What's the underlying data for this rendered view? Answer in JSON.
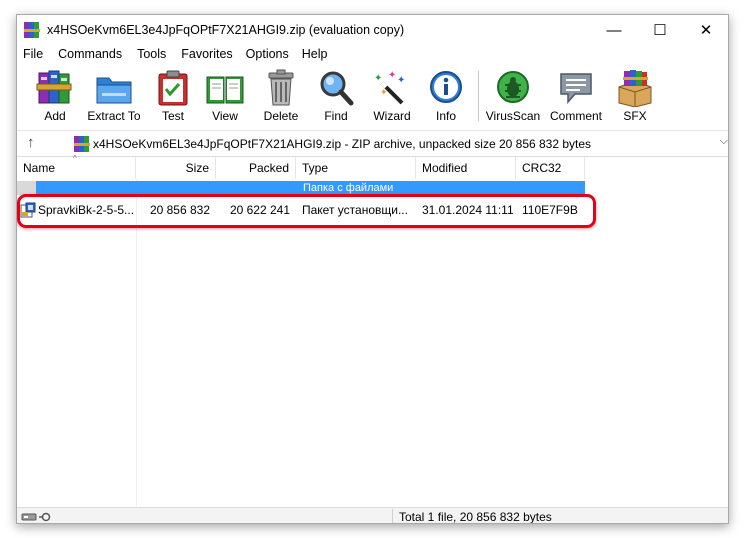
{
  "window": {
    "title": "x4HSOeKvm6EL3e4JpFqOPtF7X21AHGI9.zip (evaluation copy)",
    "minimize_glyph": "—",
    "maximize_glyph": "☐",
    "close_glyph": "✕"
  },
  "menu": [
    "File",
    "Commands",
    "Tools",
    "Favorites",
    "Options",
    "Help"
  ],
  "toolbar": {
    "add": "Add",
    "extract": "Extract To",
    "test": "Test",
    "view": "View",
    "delete": "Delete",
    "find": "Find",
    "wizard": "Wizard",
    "info": "Info",
    "virusscan": "VirusScan",
    "comment": "Comment",
    "sfx": "SFX"
  },
  "address": {
    "up_glyph": "↑",
    "text": "x4HSOeKvm6EL3e4JpFqOPtF7X21AHGI9.zip - ZIP archive, unpacked size 20 856 832 bytes",
    "dropdown_glyph": "⌵"
  },
  "columns": {
    "name": "Name",
    "size": "Size",
    "packed": "Packed",
    "type": "Type",
    "modified": "Modified",
    "crc": "CRC32",
    "sort_glyph": "^"
  },
  "group_label": "Папка с файлами",
  "file": {
    "name": "SpravkiBk-2-5-5...",
    "size": "20 856 832",
    "packed": "20 622 241",
    "type": "Пакет установщи...",
    "modified": "31.01.2024 11:11",
    "crc": "110E7F9B"
  },
  "status": {
    "text": "Total 1 file, 20 856 832 bytes"
  },
  "colors": {
    "highlight_border": "#e3001b",
    "group_bg": "#3399ff"
  },
  "icons": {
    "add": "winrar-books-icon",
    "extract": "folder-icon",
    "test": "clipboard-check-icon",
    "view": "open-book-icon",
    "delete": "trash-can-icon",
    "find": "magnifier-icon",
    "wizard": "magic-wand-icon",
    "info": "info-icon",
    "virusscan": "bug-scan-icon",
    "comment": "speech-bubble-icon",
    "sfx": "sfx-box-icon"
  }
}
